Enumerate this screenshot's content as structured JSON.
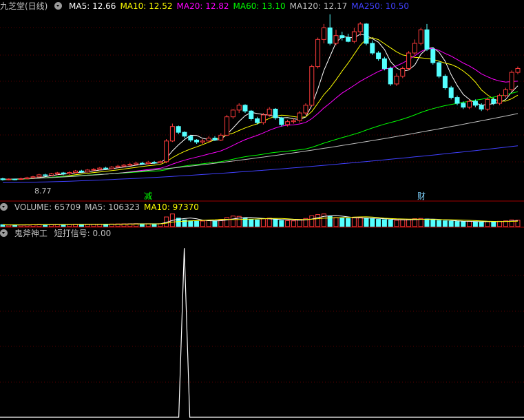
{
  "main_header": {
    "stock_title": "九芝堂(日线)",
    "items": [
      {
        "label": "MA5: 12.66",
        "color": "#ffffff"
      },
      {
        "label": "MA10: 12.52",
        "color": "#ffff00"
      },
      {
        "label": "MA20: 12.82",
        "color": "#ff00ff"
      },
      {
        "label": "MA60: 13.10",
        "color": "#00ff00"
      },
      {
        "label": "MA120: 12.17",
        "color": "#c0c0c0"
      },
      {
        "label": "MA250: 10.50",
        "color": "#4040ff"
      }
    ]
  },
  "price_low_label": "8.77",
  "markers": [
    {
      "text": "减",
      "color": "#00ff00"
    },
    {
      "text": "财",
      "color": "#7fd4ff"
    }
  ],
  "volume_header": {
    "items": [
      {
        "label": "VOLUME: 65709",
        "color": "#c0c0c0"
      },
      {
        "label": "MA5: 106323",
        "color": "#c0c0c0"
      },
      {
        "label": "MA10: 97370",
        "color": "#ffff00"
      }
    ]
  },
  "indicator_header": {
    "name": "鬼斧神工",
    "items": [
      {
        "label": "短打信号: 0.00",
        "color": "#c0c0c0"
      }
    ]
  },
  "colors": {
    "up": "#ff3c3c",
    "down": "#54ffff",
    "grid": "#5a0000",
    "separator": "#a00000"
  },
  "chart_data": {
    "type": "candlestick",
    "ylim": [
      8.5,
      17.4
    ],
    "candles": [
      [
        8.8,
        8.75,
        8.85,
        8.7
      ],
      [
        8.75,
        8.78,
        8.82,
        8.72
      ],
      [
        8.78,
        8.77,
        8.8,
        8.72
      ],
      [
        8.77,
        8.8,
        8.86,
        8.74
      ],
      [
        8.8,
        8.85,
        8.9,
        8.77
      ],
      [
        8.85,
        8.9,
        8.95,
        8.82
      ],
      [
        8.9,
        9.0,
        9.05,
        8.86
      ],
      [
        9.0,
        8.98,
        9.06,
        8.92
      ],
      [
        8.98,
        9.05,
        9.1,
        8.95
      ],
      [
        9.05,
        9.1,
        9.15,
        9.0
      ],
      [
        9.1,
        9.05,
        9.15,
        8.98
      ],
      [
        9.05,
        9.12,
        9.18,
        9.0
      ],
      [
        9.12,
        9.2,
        9.25,
        9.08
      ],
      [
        9.2,
        9.15,
        9.26,
        9.1
      ],
      [
        9.15,
        9.25,
        9.3,
        9.12
      ],
      [
        9.25,
        9.28,
        9.35,
        9.2
      ],
      [
        9.28,
        9.35,
        9.4,
        9.24
      ],
      [
        9.35,
        9.32,
        9.42,
        9.28
      ],
      [
        9.32,
        9.4,
        9.46,
        9.28
      ],
      [
        9.4,
        9.45,
        9.52,
        9.36
      ],
      [
        9.45,
        9.5,
        9.56,
        9.4
      ],
      [
        9.5,
        9.55,
        9.62,
        9.45
      ],
      [
        9.55,
        9.6,
        9.68,
        9.5
      ],
      [
        9.6,
        9.58,
        9.68,
        9.52
      ],
      [
        9.58,
        9.65,
        9.72,
        9.54
      ],
      [
        9.65,
        9.62,
        9.72,
        9.56
      ],
      [
        9.62,
        9.68,
        9.75,
        9.58
      ],
      [
        9.68,
        10.75,
        10.85,
        9.6
      ],
      [
        10.75,
        11.5,
        11.65,
        10.7
      ],
      [
        11.5,
        11.2,
        11.55,
        11.1
      ],
      [
        11.2,
        11.0,
        11.25,
        10.9
      ],
      [
        11.0,
        10.8,
        11.05,
        10.7
      ],
      [
        10.8,
        10.7,
        10.85,
        10.6
      ],
      [
        10.7,
        10.75,
        10.85,
        10.6
      ],
      [
        10.75,
        10.9,
        11.0,
        10.7
      ],
      [
        10.9,
        10.8,
        11.0,
        10.75
      ],
      [
        10.8,
        11.05,
        11.15,
        10.75
      ],
      [
        11.05,
        12.0,
        12.1,
        11.0
      ],
      [
        12.0,
        12.35,
        12.4,
        11.9
      ],
      [
        12.35,
        12.6,
        12.7,
        12.2
      ],
      [
        12.6,
        12.3,
        12.65,
        12.2
      ],
      [
        12.3,
        11.9,
        12.35,
        11.8
      ],
      [
        11.9,
        11.7,
        12.0,
        11.6
      ],
      [
        11.7,
        12.1,
        12.2,
        11.6
      ],
      [
        12.1,
        12.4,
        12.5,
        12.0
      ],
      [
        12.4,
        11.95,
        12.45,
        11.85
      ],
      [
        11.95,
        11.6,
        12.0,
        11.5
      ],
      [
        11.6,
        11.75,
        11.85,
        11.5
      ],
      [
        11.75,
        11.8,
        11.9,
        11.65
      ],
      [
        11.8,
        12.2,
        12.3,
        11.7
      ],
      [
        12.2,
        12.6,
        12.7,
        12.1
      ],
      [
        12.6,
        14.6,
        14.7,
        12.55
      ],
      [
        14.6,
        16.0,
        16.1,
        14.5
      ],
      [
        16.0,
        16.6,
        16.8,
        15.8
      ],
      [
        16.6,
        15.8,
        17.3,
        15.7
      ],
      [
        15.8,
        16.2,
        16.5,
        15.7
      ],
      [
        16.2,
        16.1,
        16.4,
        15.95
      ],
      [
        16.1,
        15.9,
        16.3,
        15.85
      ],
      [
        15.9,
        16.4,
        16.6,
        15.8
      ],
      [
        16.4,
        16.8,
        16.9,
        16.2
      ],
      [
        16.8,
        15.8,
        16.85,
        15.7
      ],
      [
        15.8,
        15.3,
        15.95,
        15.2
      ],
      [
        15.3,
        15.0,
        15.4,
        14.9
      ],
      [
        15.0,
        14.5,
        15.1,
        14.4
      ],
      [
        14.5,
        13.7,
        14.6,
        13.6
      ],
      [
        13.7,
        14.1,
        14.25,
        13.6
      ],
      [
        14.1,
        14.5,
        14.6,
        14.0
      ],
      [
        14.5,
        15.3,
        15.4,
        14.4
      ],
      [
        15.3,
        15.8,
        16.0,
        15.2
      ],
      [
        15.8,
        16.5,
        16.6,
        15.7
      ],
      [
        16.5,
        15.5,
        16.8,
        15.4
      ],
      [
        15.5,
        14.8,
        15.6,
        14.7
      ],
      [
        14.8,
        14.1,
        14.9,
        14.0
      ],
      [
        14.1,
        13.5,
        14.2,
        13.4
      ],
      [
        13.5,
        13.0,
        13.6,
        12.9
      ],
      [
        13.0,
        12.7,
        13.1,
        12.6
      ],
      [
        12.7,
        12.5,
        12.8,
        12.4
      ],
      [
        12.5,
        12.8,
        12.9,
        12.4
      ],
      [
        12.8,
        12.6,
        12.9,
        12.5
      ],
      [
        12.6,
        12.4,
        12.7,
        12.3
      ],
      [
        12.4,
        12.9,
        13.0,
        12.3
      ],
      [
        12.9,
        12.7,
        13.0,
        12.6
      ],
      [
        12.7,
        13.1,
        13.2,
        12.6
      ],
      [
        13.1,
        13.4,
        13.5,
        13.0
      ],
      [
        13.4,
        14.3,
        14.4,
        13.3
      ],
      [
        14.3,
        14.5,
        14.6,
        14.2
      ]
    ],
    "ma_series": [
      {
        "name": "MA5",
        "color": "#ffffff",
        "period": 5
      },
      {
        "name": "MA10",
        "color": "#ffff00",
        "period": 10
      },
      {
        "name": "MA20",
        "color": "#ff00ff",
        "period": 20
      },
      {
        "name": "MA60",
        "color": "#00ff00",
        "period": 60
      },
      {
        "name": "MA120",
        "color": "#c0c0c0",
        "start": 8.78,
        "end": 12.17
      },
      {
        "name": "MA250",
        "color": "#4040ff",
        "start": 8.6,
        "end": 10.5
      }
    ],
    "volume": [
      30,
      25,
      28,
      26,
      30,
      32,
      35,
      30,
      34,
      36,
      33,
      35,
      38,
      36,
      40,
      38,
      40,
      37,
      42,
      44,
      45,
      46,
      48,
      45,
      47,
      44,
      48,
      160,
      210,
      140,
      110,
      95,
      90,
      92,
      100,
      95,
      110,
      150,
      175,
      170,
      140,
      120,
      110,
      130,
      140,
      115,
      100,
      98,
      95,
      120,
      135,
      180,
      200,
      210,
      170,
      150,
      140,
      135,
      145,
      150,
      140,
      130,
      120,
      115,
      110,
      105,
      110,
      120,
      130,
      135,
      125,
      110,
      100,
      95,
      90,
      85,
      80,
      85,
      82,
      78,
      85,
      80,
      88,
      95,
      110,
      105
    ],
    "volume_max": 230,
    "signal": {
      "spike_index": 27,
      "value_peak": 1,
      "ylim": [
        0,
        1.05
      ]
    }
  }
}
